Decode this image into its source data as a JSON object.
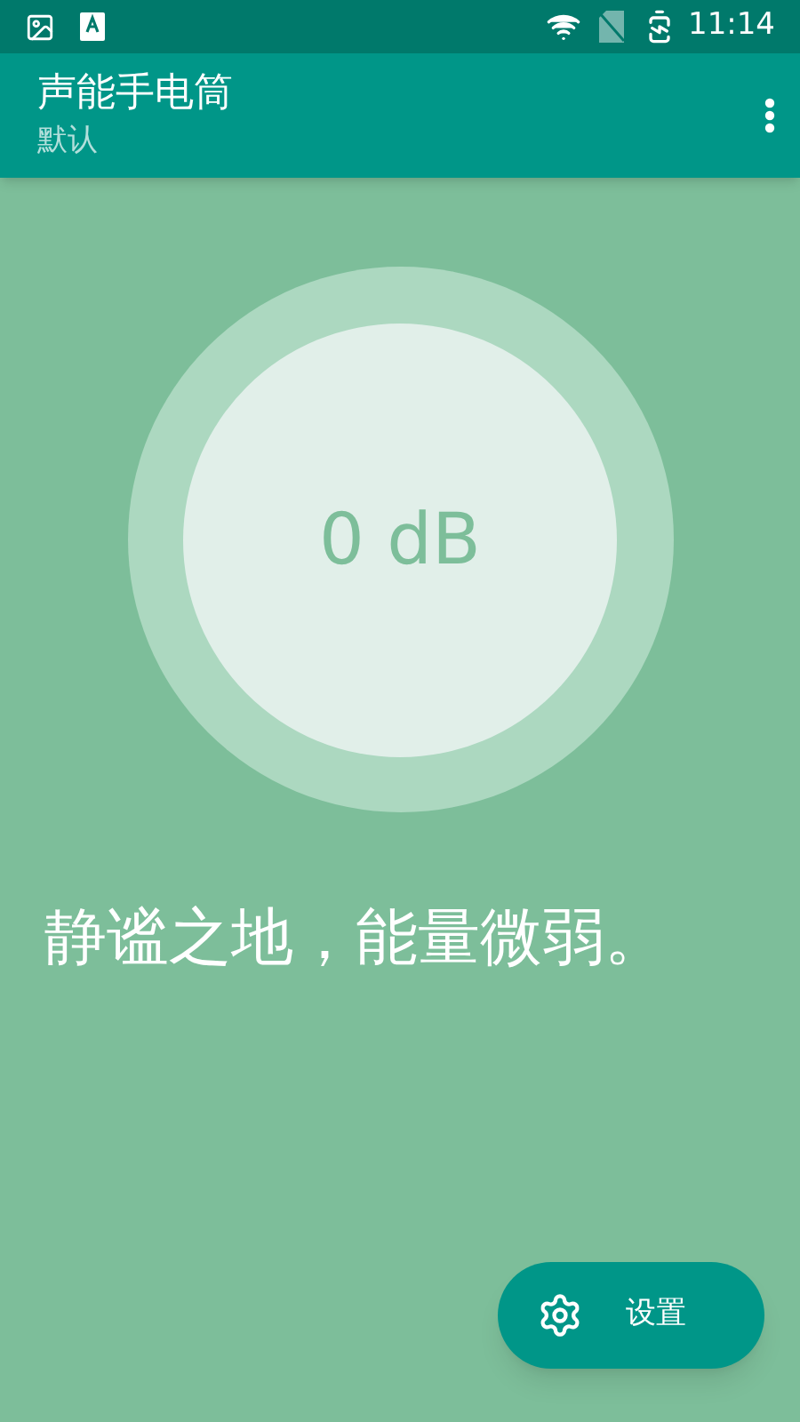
{
  "status_bar": {
    "time": "11:14"
  },
  "app_bar": {
    "title": "声能手电筒",
    "subtitle": "默认"
  },
  "meter": {
    "reading": "0 dB"
  },
  "message": "静谧之地，能量微弱。",
  "fab": {
    "label": "设置"
  }
}
